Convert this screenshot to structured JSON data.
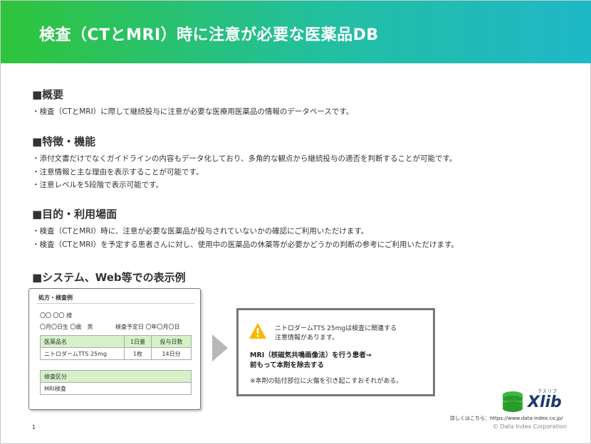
{
  "header": {
    "title": "検査（CTとMRI）時に注意が必要な医薬品DB"
  },
  "overview": {
    "heading": "■概要",
    "bullets": [
      "・検査（CTとMRI）に際して継続投与に注意が必要な医療用医薬品の情報のデータベースです。"
    ]
  },
  "features": {
    "heading": "■特徴・機能",
    "bullets": [
      "・添付文書だけでなくガイドラインの内容もデータ化しており、多角的な観点から継続投与の適否を判断することが可能です。",
      "・注意情報と主な理由を表示することが可能です。",
      "・注意レベルを5段階で表示可能です。"
    ]
  },
  "purpose": {
    "heading": "■目的・利用場面",
    "bullets": [
      "・検査（CTとMRI）時に、注意が必要な医薬品が投与されていないかの確認にご利用いただけます。",
      "・検査（CTとMRI）を予定する患者さんに対し、使用中の医薬品の休薬等が必要かどうかの判断の参考にご利用いただけます。"
    ]
  },
  "display_example": {
    "heading": "■システム、Web等での表示例"
  },
  "mock_card": {
    "title": "処方・検査例",
    "patient_name": "〇〇 〇〇 様",
    "patient_info": "〇月〇日生 〇歳　男",
    "exam_date": "検査予定日 〇年〇月〇日",
    "drug_table": {
      "headers": [
        "医薬品名",
        "1日量",
        "投与日数"
      ],
      "rows": [
        [
          "ニトロダームTTS 25mg",
          "1枚",
          "14日分"
        ]
      ]
    },
    "exam_table": {
      "header": "検査区分",
      "value": "MRI検査"
    }
  },
  "warning_box": {
    "line1": "ニトロダームTTS 25mgは検査に関連する",
    "line2": "注意情報があります。",
    "strong1": "MRI（核磁気共鳴画像法）を行う患者→",
    "strong2": "前もって本剤を除去する",
    "note": "※本剤の貼付部位に火傷を引き起こすおそれがある。"
  },
  "logo": {
    "word": "Xlib",
    "kana": "クスリブ"
  },
  "footer": {
    "link_text": "詳しくはこちら：https://www.data-index.co.jp/",
    "copyright": "© Data Index Corporation",
    "page_number": "1"
  },
  "colors": {
    "header_start": "#2fc43a",
    "header_end": "#1fb8c8",
    "table_header": "#d6f1c8",
    "warning_icon": "#f5b800",
    "logo_navy": "#1e3a6e",
    "logo_green": "#3cb83c"
  }
}
